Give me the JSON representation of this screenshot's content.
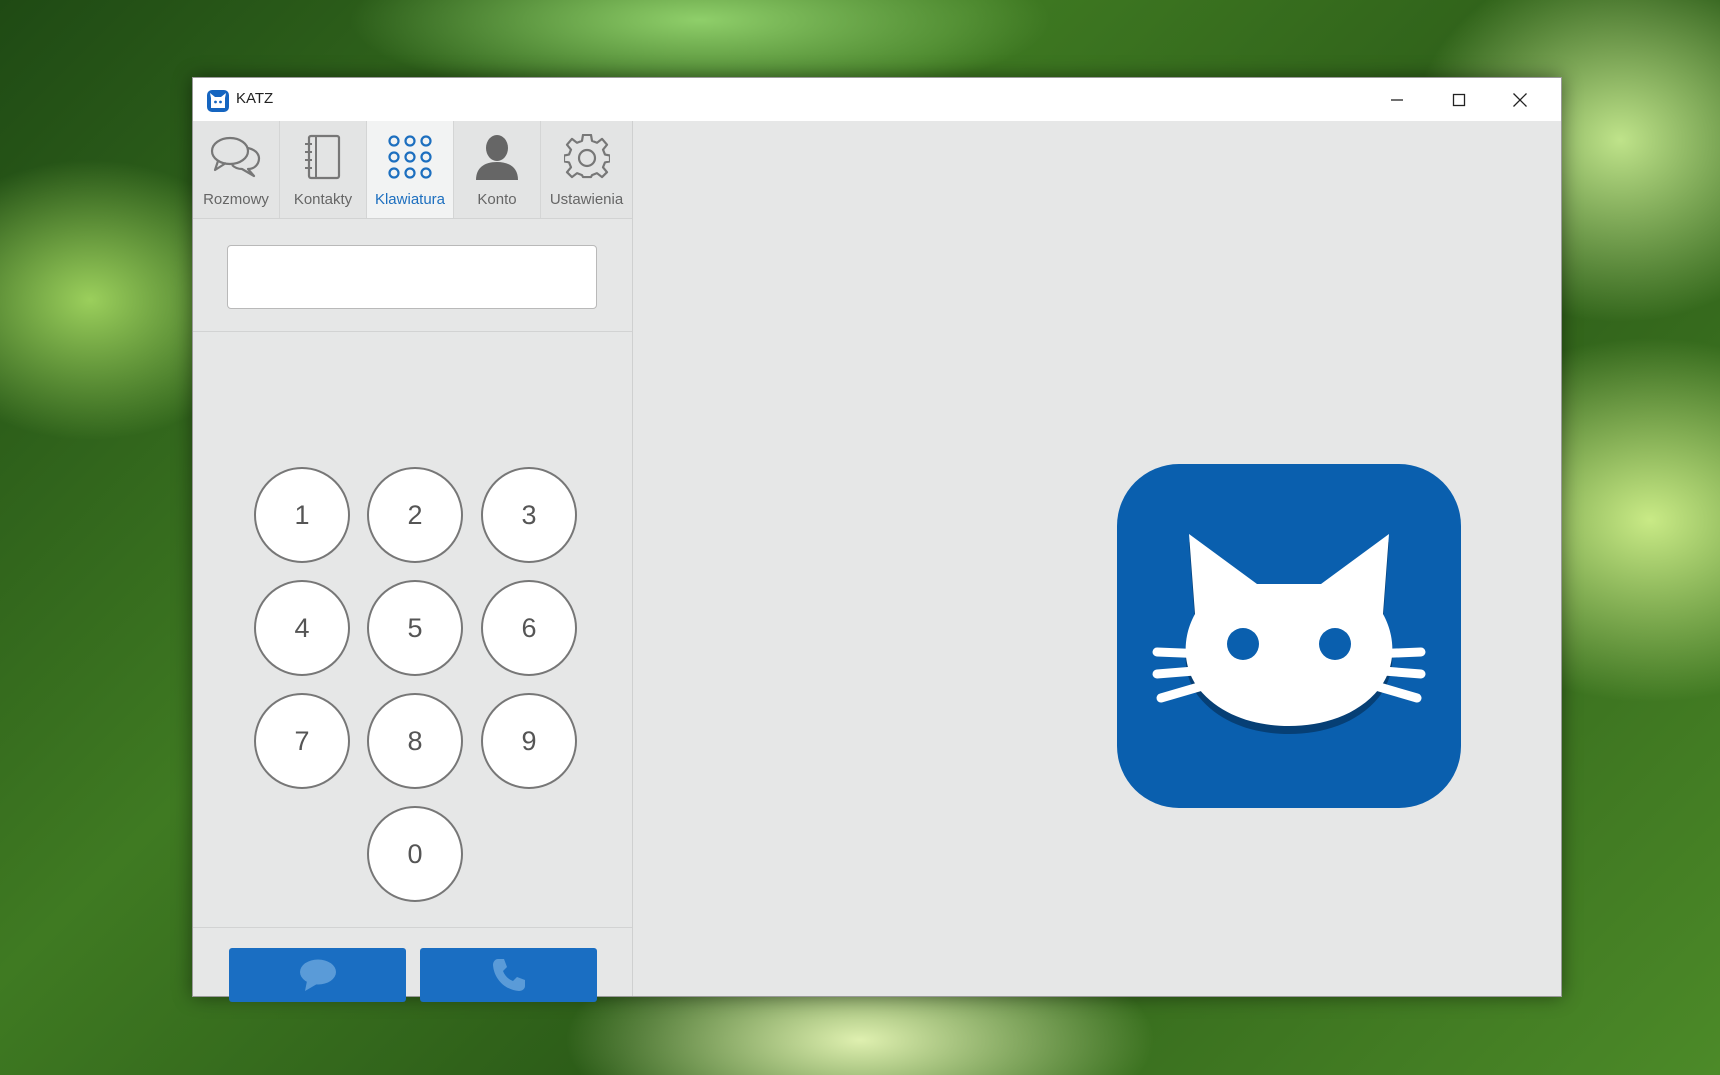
{
  "window": {
    "title": "KATZ",
    "app_icon": "katz-cat-icon",
    "controls": [
      "minimize-icon",
      "maximize-icon",
      "close-icon"
    ]
  },
  "tabs": [
    {
      "label": "Rozmowy",
      "icon": "chat-bubbles-icon",
      "active": false
    },
    {
      "label": "Kontakty",
      "icon": "address-book-icon",
      "active": false
    },
    {
      "label": "Klawiatura",
      "icon": "dialpad-icon",
      "active": true
    },
    {
      "label": "Konto",
      "icon": "person-icon",
      "active": false
    },
    {
      "label": "Ustawienia",
      "icon": "gear-icon",
      "active": false
    }
  ],
  "dialer": {
    "number_value": "",
    "keys": [
      "1",
      "2",
      "3",
      "4",
      "5",
      "6",
      "7",
      "8",
      "9",
      "0"
    ]
  },
  "actions": {
    "message_icon": "chat-bubble-icon",
    "call_icon": "phone-icon"
  },
  "colors": {
    "accent": "#1a6ec2",
    "logo_bg": "#0a5fae",
    "active_tab_text": "#1d6fbf"
  },
  "main": {
    "logo_icon": "katz-logo-icon"
  }
}
